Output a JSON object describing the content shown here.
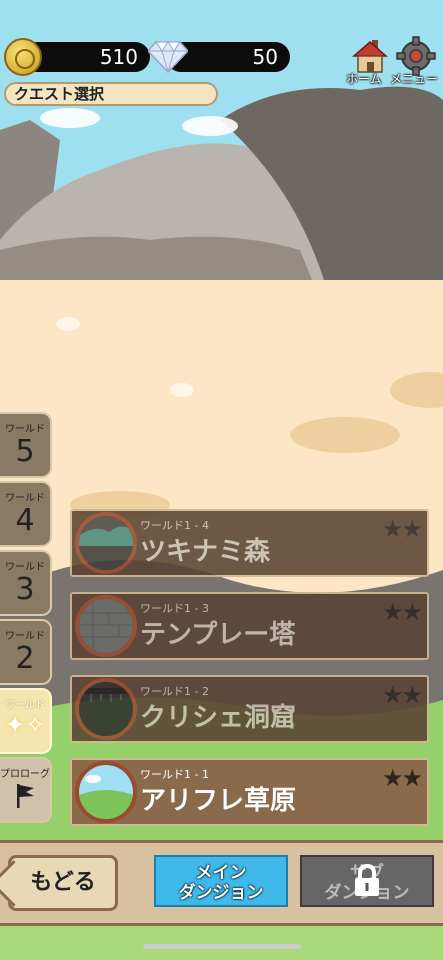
{
  "currency": {
    "coins": "510",
    "gems": "50"
  },
  "top_icons": {
    "home_label": "ホーム",
    "menu_label": "メニュー"
  },
  "quest_title": "クエスト選択",
  "worlds": [
    {
      "label": "ワールド",
      "number": "5"
    },
    {
      "label": "ワールド",
      "number": "4"
    },
    {
      "label": "ワールド",
      "number": "3"
    },
    {
      "label": "ワールド",
      "number": "2"
    },
    {
      "label": "ワールド",
      "number": ""
    },
    {
      "label": "プロローグ",
      "number": ""
    }
  ],
  "dungeons": [
    {
      "sub": "ワールド1 - 4",
      "name": "ツキナミ森",
      "stars": "★★"
    },
    {
      "sub": "ワールド1 - 3",
      "name": "テンプレー塔",
      "stars": "★★"
    },
    {
      "sub": "ワールド1 - 2",
      "name": "クリシェ洞窟",
      "stars": "★★"
    },
    {
      "sub": "ワールド1 - 1",
      "name": "アリフレ草原",
      "stars": "★★"
    }
  ],
  "buttons": {
    "back": "もどる",
    "main_line1": "メイン",
    "main_line2": "ダンジョン",
    "sub_line1": "サブ",
    "sub_line2": "ダンジョン"
  },
  "colors": {
    "accent": "#3fb8ea",
    "plate": "#5a4434",
    "frame": "#9a4b2e"
  }
}
